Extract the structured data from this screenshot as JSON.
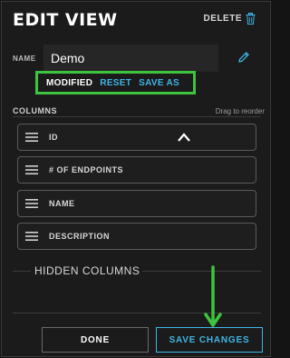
{
  "header": {
    "title": "EDIT VIEW",
    "delete_label": "DELETE"
  },
  "name": {
    "label": "NAME",
    "value": "Demo"
  },
  "status": {
    "modified_label": "MODIFIED",
    "reset_label": "RESET",
    "save_as_label": "SAVE AS"
  },
  "columns": {
    "label": "COLUMNS",
    "hint": "Drag to reorder",
    "items": [
      {
        "label": "ID"
      },
      {
        "label": "# OF ENDPOINTS"
      },
      {
        "label": "NAME"
      },
      {
        "label": "DESCRIPTION"
      }
    ]
  },
  "hidden_columns": {
    "label": "HIDDEN COLUMNS"
  },
  "footer": {
    "done_label": "DONE",
    "save_label": "SAVE CHANGES"
  },
  "colors": {
    "accent": "#3fb5e6",
    "highlight": "#3ec43e",
    "background": "#1b1b1b"
  }
}
